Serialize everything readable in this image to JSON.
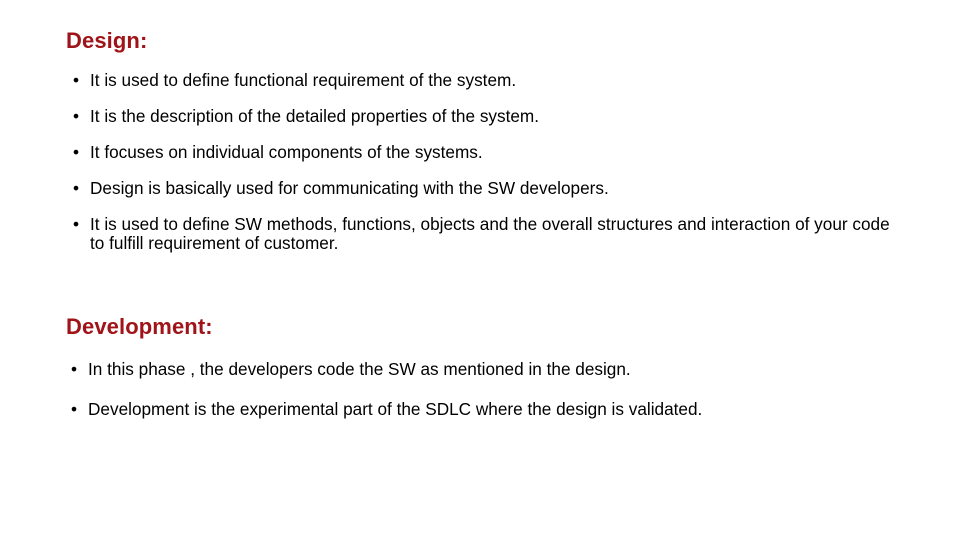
{
  "slide": {
    "background_color": "#FFFFFF",
    "heading_color": "#A01318",
    "body_color": "#000000",
    "bullet_glyph": "•"
  },
  "sections": [
    {
      "heading": "Design:",
      "bullets": [
        "It is used to define functional requirement of the system.",
        "It is the description of the detailed properties of the system.",
        "It focuses on individual components of the systems.",
        "Design is basically used for communicating with the SW developers.",
        "It is used to define SW methods, functions, objects and the overall structures and interaction of your code to fulfill requirement of customer."
      ]
    },
    {
      "heading": "Development:",
      "bullets": [
        "In this phase , the developers code the SW as mentioned in the design.",
        "Development is the experimental part of the SDLC where the design is validated."
      ]
    }
  ]
}
